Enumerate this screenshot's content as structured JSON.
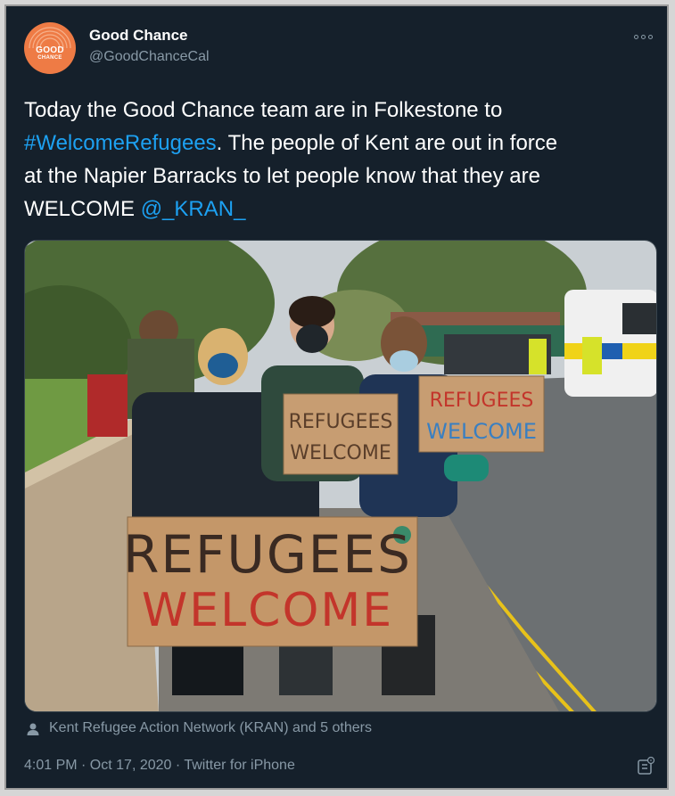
{
  "profile": {
    "display_name": "Good Chance",
    "handle": "@GoodChanceCal",
    "avatar_line1": "GOOD",
    "avatar_line2": "CHANCE"
  },
  "tweet": {
    "text_part1": "Today the Good Chance team are in Folkestone to",
    "hashtag": "#WelcomeRefugees",
    "text_part2": ". The people of Kent are out in force",
    "text_part3": "at the Napier Barracks to let people know that they are",
    "text_part4": "WELCOME ",
    "mention": "@_KRAN_"
  },
  "photo": {
    "sign_large_line1": "REFUGEES",
    "sign_large_line2": "WELCOME",
    "sign_middle_line1": "REFUGEES",
    "sign_middle_line2": "WELCOME",
    "sign_right_line1": "REFUGEES",
    "sign_right_line2": "WELCOME"
  },
  "tags": {
    "text": "Kent Refugee Action Network (KRAN) and 5 others"
  },
  "meta": {
    "timestamp": "4:01 PM · Oct 17, 2020 · Twitter for iPhone"
  },
  "colors": {
    "background": "#15202b",
    "link": "#1da1f2",
    "secondary_text": "#8899a6",
    "avatar": "#ee7b45"
  }
}
